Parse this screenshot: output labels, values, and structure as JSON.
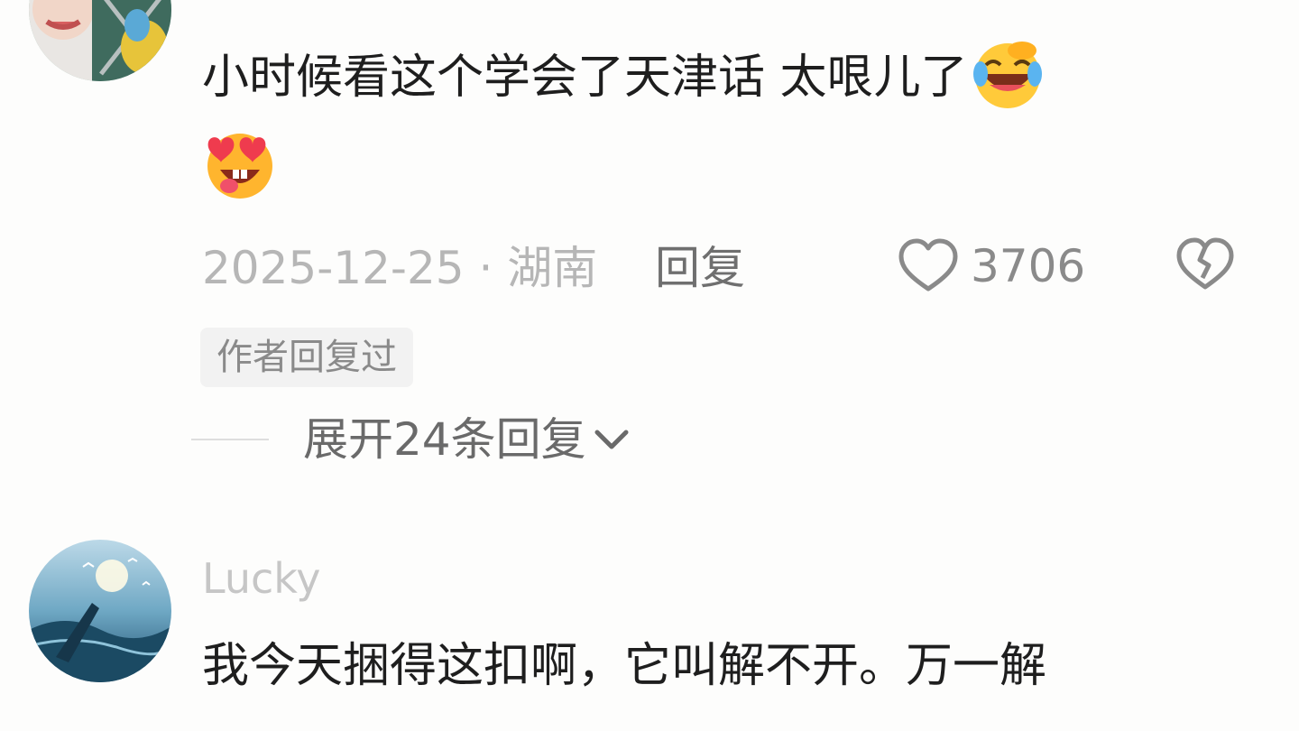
{
  "comments": [
    {
      "text": "小时候看这个学会了天津话 太哏儿了",
      "emojis": [
        "rolling-laughing-emoji",
        "heart-eyes-tongue-emoji"
      ],
      "date": "2025-12-25",
      "location": "湖南",
      "reply_label": "回复",
      "likes": "3706",
      "author_badge": "作者回复过",
      "expand_label": "展开24条回复"
    },
    {
      "username": "Lucky",
      "text": "我今天捆得这扣啊，它叫解不开。万一解"
    }
  ],
  "icons": {
    "like": "heart-outline-icon",
    "dislike": "broken-heart-icon",
    "expand": "chevron-down-icon"
  },
  "colors": {
    "background": "#fdfdfc",
    "text": "#1e1e1e",
    "meta": "#b6b6b6",
    "secondary": "#6f6f6f",
    "badge_bg": "#f2f2f2"
  }
}
